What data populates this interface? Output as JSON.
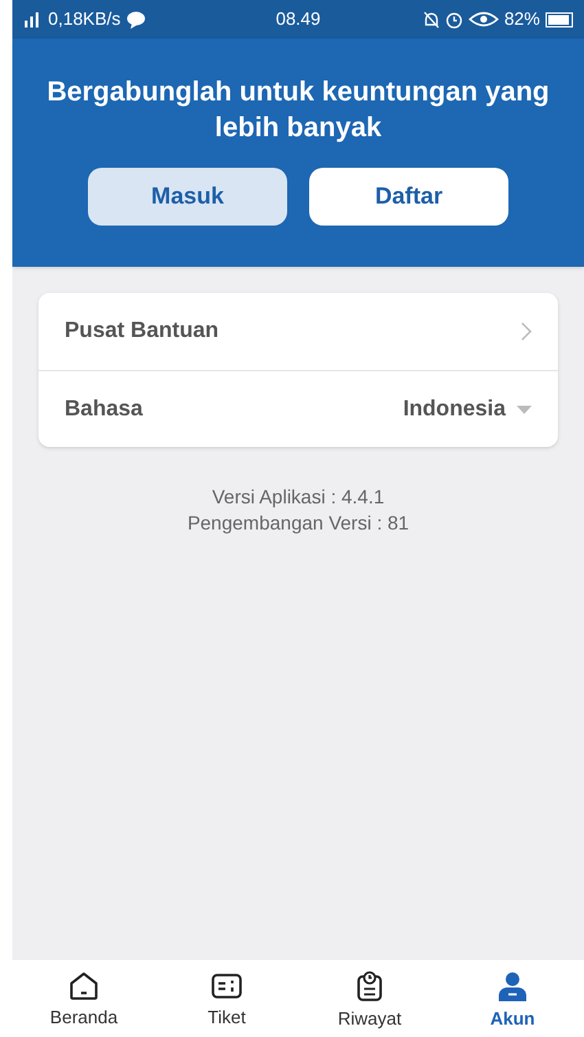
{
  "status_bar": {
    "network": "0,18KB/s",
    "time": "08.49",
    "battery": "82%"
  },
  "header": {
    "title": "Bergabunglah untuk keuntungan yang lebih banyak",
    "buttons": [
      {
        "label": "Masuk",
        "kind": "secondary"
      },
      {
        "label": "Daftar",
        "kind": "primary"
      }
    ]
  },
  "settings": [
    {
      "label": "Pusat Bantuan",
      "kind": "link"
    },
    {
      "label": "Bahasa",
      "kind": "select",
      "value": "Indonesia"
    }
  ],
  "version": [
    "Versi Aplikasi : 4.4.1",
    "Pengembangan Versi : 81"
  ],
  "nav": [
    {
      "label": "Beranda",
      "kind": "home",
      "selected": false
    },
    {
      "label": "Tiket",
      "kind": "ticket",
      "selected": false
    },
    {
      "label": "Riwayat",
      "kind": "history",
      "selected": false
    },
    {
      "label": "Akun",
      "kind": "account",
      "selected": true
    }
  ]
}
